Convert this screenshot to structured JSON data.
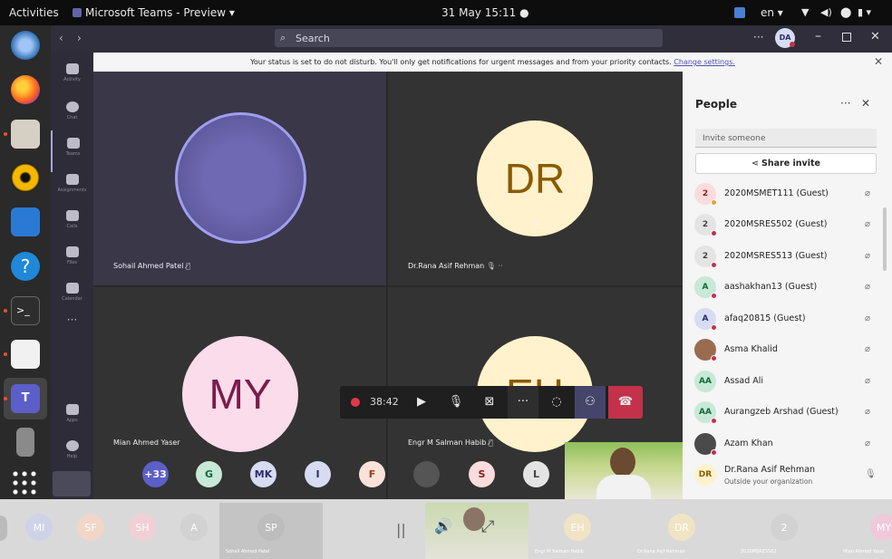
{
  "topbar": {
    "activities": "Activities",
    "app_menu": "Microsoft Teams - Preview ▾",
    "clock": "31 May  15:11  ●",
    "language": "en ▾"
  },
  "titlebar": {
    "search_placeholder": "Search",
    "avatar_initials": "DA"
  },
  "rail": [
    {
      "label": "Activity"
    },
    {
      "label": "Chat"
    },
    {
      "label": "Teams"
    },
    {
      "label": "Assignments"
    },
    {
      "label": "Calls"
    },
    {
      "label": "Files"
    },
    {
      "label": "Calendar"
    },
    {
      "label": "Apps"
    },
    {
      "label": "Help"
    }
  ],
  "banner": {
    "text": "Your status is set to do not disturb. You'll only get notifications for urgent messages and from your priority contacts.",
    "link": "Change settings."
  },
  "tiles": [
    {
      "name": "Sohail Ahmed Patel",
      "initials": ""
    },
    {
      "name": "Dr.Rana Asif Rehman",
      "initials": "DR"
    },
    {
      "name": "Mian Ahmed Yaser",
      "initials": "MY"
    },
    {
      "name": "Engr M Salman Habib",
      "initials": "EH"
    }
  ],
  "overflow_avatars": [
    {
      "initials": "+33",
      "color": "#5b5fc7"
    },
    {
      "initials": "G",
      "color": "#c8e8d8"
    },
    {
      "initials": "MK",
      "color": "#d7dcf2"
    },
    {
      "initials": "I",
      "color": "#d7dcf2"
    },
    {
      "initials": "F",
      "color": "#fbe2d9"
    },
    {
      "initials": "",
      "color": "#555555"
    },
    {
      "initials": "S",
      "color": "#fbdcdc"
    },
    {
      "initials": "L",
      "color": "#e4e4e4"
    }
  ],
  "callbar": {
    "timer": "38:42"
  },
  "people": {
    "title": "People",
    "invite_placeholder": "Invite someone",
    "share_label": "Share invite",
    "list": [
      {
        "initial": "2",
        "name": "2020MSMET111 (Guest)",
        "color": "#fbdcdc"
      },
      {
        "initial": "2",
        "name": "2020MSRES502 (Guest)",
        "color": "#e4e4e4"
      },
      {
        "initial": "2",
        "name": "2020MSRES513 (Guest)",
        "color": "#e4e4e4"
      },
      {
        "initial": "A",
        "name": "aashakhan13 (Guest)",
        "color": "#c8e8d8"
      },
      {
        "initial": "A",
        "name": "afaq20815 (Guest)",
        "color": "#d7dcf2"
      },
      {
        "initial": "",
        "name": "Asma Khalid",
        "color": "#9a6b4f"
      },
      {
        "initial": "AA",
        "name": "Assad Ali",
        "color": "#c8e8d8"
      },
      {
        "initial": "AA",
        "name": "Aurangzeb Arshad (Guest)",
        "color": "#c8e8d8"
      },
      {
        "initial": "",
        "name": "Azam Khan",
        "color": "#4a4a4a"
      },
      {
        "initial": "DR",
        "name": "Dr.Rana Asif Rehman",
        "color": "#fff2cc"
      }
    ],
    "outside_note": "Outside your organization"
  },
  "strip": [
    {
      "initials": "MI",
      "name": ""
    },
    {
      "initials": "SF",
      "name": ""
    },
    {
      "initials": "SH",
      "name": ""
    },
    {
      "initials": "A",
      "name": ""
    },
    {
      "initials": "SP",
      "name": "Sohail Ahmed Patel"
    },
    {
      "initials": "EH",
      "name": "Engr M Salman Habib"
    },
    {
      "initials": "DR",
      "name": "Dr.Rana Asif Rehman"
    },
    {
      "initials": "2",
      "name": "2020MSRES502"
    },
    {
      "initials": "MY",
      "name": "Mian Ahmed Yaser"
    }
  ],
  "colors": {
    "accent": "#5b5fc7",
    "hangup": "#c4314b",
    "dr_avatar_bg": "#fff2cc",
    "dr_avatar_fg": "#8a5a00",
    "my_avatar_bg": "#fbdceb",
    "my_avatar_fg": "#7a1c4a"
  }
}
